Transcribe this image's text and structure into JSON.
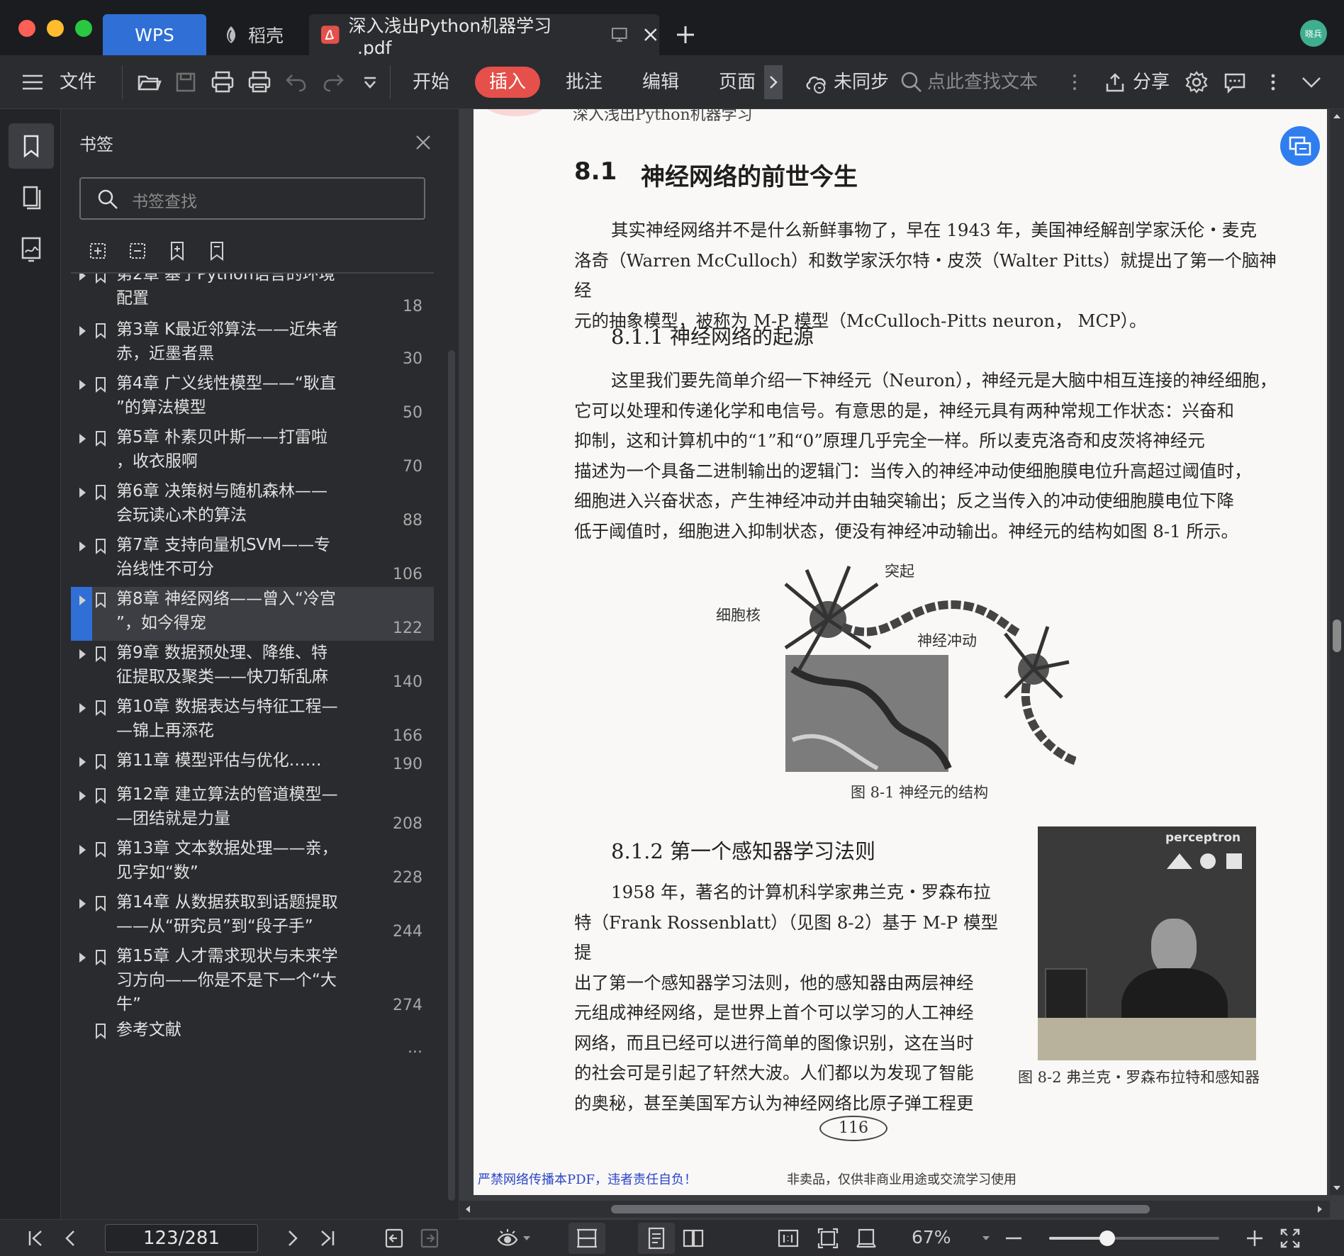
{
  "window": {
    "tabs": [
      {
        "label": "WPS"
      },
      {
        "label": "稻壳"
      },
      {
        "label": "深入浅出Python机器学习_.pdf"
      }
    ],
    "avatar_text": "晓兵"
  },
  "toolbar": {
    "file_label": "文件",
    "menus": [
      "开始",
      "插入",
      "批注",
      "编辑",
      "页面"
    ],
    "sync_label": "未同步",
    "search_placeholder": "点此查找文本",
    "share_label": "分享"
  },
  "colors": {
    "accent": "#2f6fd6",
    "active_menu": "#e5504a",
    "watermark": "#2b43c9"
  },
  "bookmarks": {
    "title": "书签",
    "search_placeholder": "书签查找",
    "partial_first": {
      "line1": "第2章 基于Python语言的环境",
      "line2": "配置",
      "page": "18"
    },
    "items": [
      {
        "line1": "第3章 K最近邻算法——近朱者",
        "line2": "赤，近墨者黑",
        "page": "30"
      },
      {
        "line1": "第4章 广义线性模型——“耿直",
        "line2": "”的算法模型",
        "page": "50"
      },
      {
        "line1": "第5章 朴素贝叶斯——打雷啦",
        "line2": "，收衣服啊",
        "page": "70"
      },
      {
        "line1": "第6章 决策树与随机森林——",
        "line2": "会玩读心术的算法",
        "page": "88"
      },
      {
        "line1": "第7章 支持向量机SVM——专",
        "line2": "治线性不可分",
        "page": "106"
      },
      {
        "line1": "第8章 神经网络——曾入“冷宫",
        "line2": "”，如今得宠",
        "page": "122"
      },
      {
        "line1": "第9章 数据预处理、降维、特",
        "line2": "征提取及聚类——快刀斩乱麻",
        "page": "140"
      },
      {
        "line1": "第10章 数据表达与特征工程—",
        "line2": "—锦上再添花",
        "page": "166"
      },
      {
        "line1": "第11章 模型评估与优化……",
        "line2": "",
        "page": "190"
      },
      {
        "line1": "第12章 建立算法的管道模型—",
        "line2": "—团结就是力量",
        "page": "208"
      },
      {
        "line1": "第13章 文本数据处理——亲，",
        "line2": "见字如“数”",
        "page": "228"
      },
      {
        "line1": "第14章 从数据获取到话题提取",
        "line2": "——从“研究员”到“段子手”",
        "page": "244"
      },
      {
        "line1": "第15章 人才需求现状与未来学",
        "line2": "习方向——你是不是下一个“大",
        "line3": "牛”",
        "page": "274"
      },
      {
        "line1": "参考文献",
        "line2": "",
        "page": "..."
      }
    ]
  },
  "document": {
    "running_header": "深入浅出Python机器学习",
    "h1_num": "8.1",
    "h1_text": "神经网络的前世今生",
    "para1": [
      "其实神经网络并不是什么新鲜事物了，早在 1943 年，美国神经解剖学家沃伦・麦克",
      "洛奇（Warren McCulloch）和数学家沃尔特・皮茨（Walter Pitts）就提出了第一个脑神经",
      "元的抽象模型，被称为 M-P 模型（McCulloch-Pitts neuron， MCP）。"
    ],
    "h2a": "8.1.1   神经网络的起源",
    "para2": [
      "这里我们要先简单介绍一下神经元（Neuron），神经元是大脑中相互连接的神经细胞，",
      "它可以处理和传递化学和电信号。有意思的是，神经元具有两种常规工作状态：兴奋和",
      "抑制，这和计算机中的“1”和“0”原理几乎完全一样。所以麦克洛奇和皮茨将神经元",
      "描述为一个具备二进制输出的逻辑门：当传入的神经冲动使细胞膜电位升高超过阈值时，",
      "细胞进入兴奋状态，产生神经冲动并由轴突输出；反之当传入的冲动使细胞膜电位下降",
      "低于阈值时，细胞进入抑制状态，便没有神经冲动输出。神经元的结构如图 8-1 所示。"
    ],
    "fig1_labels": {
      "tuqi": "突起",
      "xibaohe": "细胞核",
      "shenjing": "神经冲动"
    },
    "fig1_caption": "图 8-1    神经元的结构",
    "h2b": "8.1.2   第一个感知器学习法则",
    "para3": [
      "1958 年，著名的计算机科学家弗兰克・罗森布拉",
      "特（Frank Rossenblatt）（见图 8-2）基于 M-P 模型提",
      "出了第一个感知器学习法则，他的感知器由两层神经",
      "元组成神经网络，是世界上首个可以学习的人工神经",
      "网络，而且已经可以进行简单的图像识别，这在当时",
      "的社会可是引起了轩然大波。人们都以为发现了智能",
      "的奥秘，甚至美国军方认为神经网络比原子弹工程更"
    ],
    "photo_label": "perceptron",
    "fig2_caption": "图 8-2    弗兰克・罗森布拉特和感知器",
    "page_number": "116",
    "footer_left": "严禁网络传播本PDF，违者责任自负！",
    "footer_right": "非卖品，仅供非商业用途或交流学习使用"
  },
  "status": {
    "page_indicator": "123/281",
    "zoom": "67%",
    "zoom_level": 0.34
  }
}
